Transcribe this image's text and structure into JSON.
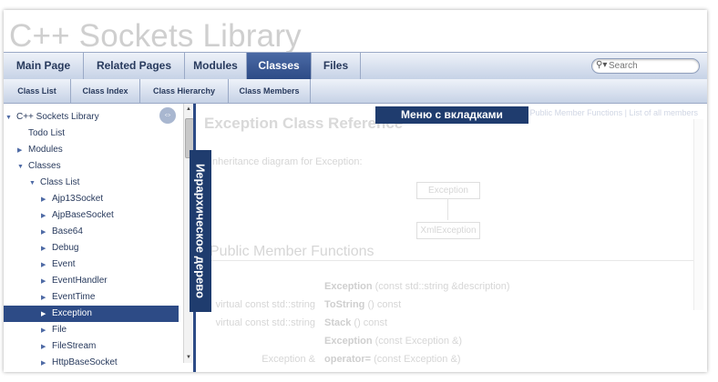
{
  "title": "C++ Sockets Library",
  "main_tabs": [
    {
      "label": "Main Page",
      "active": false
    },
    {
      "label": "Related Pages",
      "active": false
    },
    {
      "label": "Modules",
      "active": false
    },
    {
      "label": "Classes",
      "active": true
    },
    {
      "label": "Files",
      "active": false
    }
  ],
  "search": {
    "placeholder": "Search"
  },
  "sub_tabs": [
    "Class List",
    "Class Index",
    "Class Hierarchy",
    "Class Members"
  ],
  "tree": [
    {
      "label": "C++ Sockets Library",
      "arrow": "▼",
      "level": 0
    },
    {
      "label": "Todo List",
      "arrow": "",
      "level": 1
    },
    {
      "label": "Modules",
      "arrow": "▶",
      "level": 1
    },
    {
      "label": "Classes",
      "arrow": "▼",
      "level": 1
    },
    {
      "label": "Class List",
      "arrow": "▼",
      "level": 2
    },
    {
      "label": "Ajp13Socket",
      "arrow": "▶",
      "level": 3
    },
    {
      "label": "AjpBaseSocket",
      "arrow": "▶",
      "level": 3
    },
    {
      "label": "Base64",
      "arrow": "▶",
      "level": 3
    },
    {
      "label": "Debug",
      "arrow": "▶",
      "level": 3
    },
    {
      "label": "Event",
      "arrow": "▶",
      "level": 3
    },
    {
      "label": "EventHandler",
      "arrow": "▶",
      "level": 3
    },
    {
      "label": "EventTime",
      "arrow": "▶",
      "level": 3
    },
    {
      "label": "Exception",
      "arrow": "▶",
      "level": 3,
      "selected": true
    },
    {
      "label": "File",
      "arrow": "▶",
      "level": 3
    },
    {
      "label": "FileStream",
      "arrow": "▶",
      "level": 3
    },
    {
      "label": "HttpBaseSocket",
      "arrow": "▶",
      "level": 3
    }
  ],
  "overlay_labels": {
    "tabs_menu": "Меню с вкладками",
    "hierarchy_tree": "Иерархическое дерево"
  },
  "content": {
    "nav_links": "Public Member Functions | List of all members",
    "class_title": "Exception Class Reference",
    "inheritance_label": "Inheritance diagram for Exception:",
    "diagram_parent": "Exception",
    "diagram_child": "XmlException",
    "section_title": "Public Member Functions",
    "members": [
      {
        "ret": "",
        "name": "Exception",
        "args": " (const std::string &description)"
      },
      {
        "ret": "virtual const std::string",
        "name": "ToString",
        "args": " () const"
      },
      {
        "ret": "virtual const std::string",
        "name": "Stack",
        "args": " () const"
      },
      {
        "ret": "",
        "name": "Exception",
        "args": " (const Exception &)"
      },
      {
        "ret": "Exception &",
        "name": "operator=",
        "args": " (const Exception &)"
      }
    ]
  },
  "colors": {
    "accent": "#2d4b86",
    "label_bg": "#1f3c6e"
  }
}
